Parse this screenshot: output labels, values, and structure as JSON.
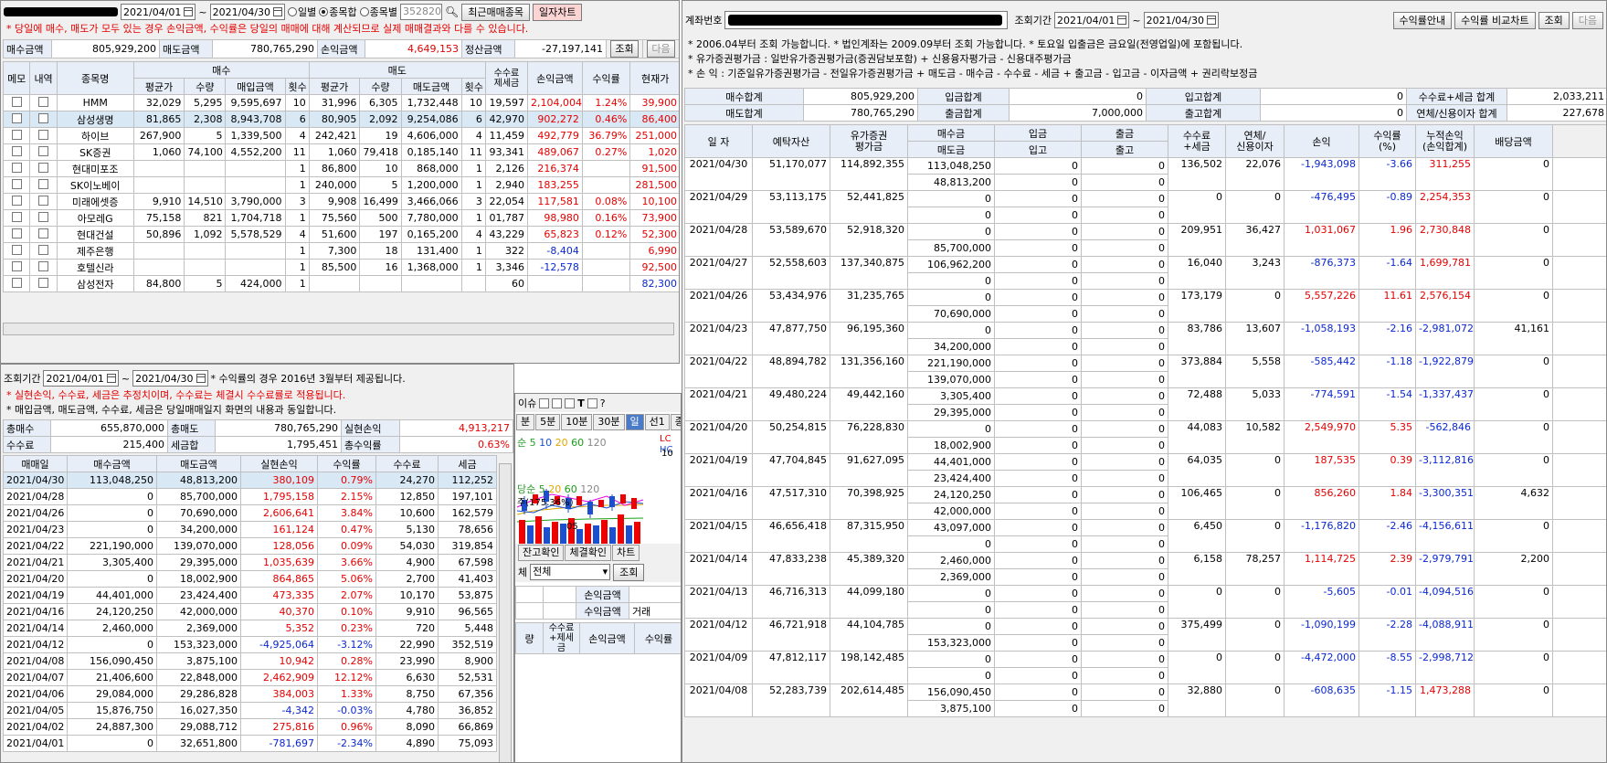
{
  "tl": {
    "date_from": "2021/04/01",
    "date_sep": "~",
    "date_to": "2021/04/30",
    "radio1": "일별",
    "radio2": "종목합",
    "radio3": "종목별",
    "code": "352820",
    "recent_btn": "최근매매종목",
    "daily_chart_btn": "일자차트",
    "warn": "* 당일에 매수, 매도가 모두 있는 경우 손익금액, 수익률은 당일의 매매에 대해 계산되므로 실제 매매결과와 다를 수 있습니다.",
    "s_buy_label": "매수금액",
    "s_buy": "805,929,200",
    "s_sell_label": "매도금액",
    "s_sell": "780,765,290",
    "s_pl_label": "손익금액",
    "s_pl": "4,649,153",
    "s_settle_label": "정산금액",
    "s_settle": "-27,197,141",
    "query_btn": "조회",
    "next_btn": "다음",
    "h_memo": "메모",
    "h_detail": "내역",
    "h_name": "종목명",
    "h_buy": "매수",
    "h_sell": "매도",
    "h_avg": "평균가",
    "h_qty": "수량",
    "h_buy_amt": "매입금액",
    "h_cnt": "횟수",
    "h_sell_amt": "매도금액",
    "h_fee": "수수료\n제세금",
    "h_pl": "손익금액",
    "h_rate": "수익률",
    "h_cur": "현재가",
    "rows": [
      {
        "name": "HMM",
        "ba": "32,029",
        "bq": "5,295",
        "bamt": "9,595,697",
        "bc": "10",
        "sa": "31,996",
        "sq": "6,305",
        "samt": "1,732,448",
        "sc": "10",
        "fee": "19,597",
        "pl": "2,104,004",
        "rate": "1.24%",
        "cur": "39,900"
      },
      {
        "name": "삼성생명",
        "ba": "81,865",
        "bq": "2,308",
        "bamt": "8,943,708",
        "bc": "6",
        "sa": "80,905",
        "sq": "2,092",
        "samt": "9,254,086",
        "sc": "6",
        "fee": "42,970",
        "pl": "902,272",
        "rate": "0.46%",
        "cur": "86,400"
      },
      {
        "name": "하이브",
        "ba": "267,900",
        "bq": "5",
        "bamt": "1,339,500",
        "bc": "4",
        "sa": "242,421",
        "sq": "19",
        "samt": "4,606,000",
        "sc": "4",
        "fee": "11,459",
        "pl": "492,779",
        "rate": "36.79%",
        "cur": "251,000"
      },
      {
        "name": "SK증권",
        "ba": "1,060",
        "bq": "74,100",
        "bamt": "4,552,200",
        "bc": "11",
        "sa": "1,060",
        "sq": "79,418",
        "samt": "0,185,140",
        "sc": "11",
        "fee": "93,341",
        "pl": "489,067",
        "rate": "0.27%",
        "cur": "1,020"
      },
      {
        "name": "현대미포조",
        "ba": "",
        "bq": "",
        "bamt": "",
        "bc": "1",
        "sa": "86,800",
        "sq": "10",
        "samt": "868,000",
        "sc": "1",
        "fee": "2,126",
        "pl": "216,374",
        "rate": "",
        "cur": "91,500"
      },
      {
        "name": "SK이노베이",
        "ba": "",
        "bq": "",
        "bamt": "",
        "bc": "1",
        "sa": "240,000",
        "sq": "5",
        "samt": "1,200,000",
        "sc": "1",
        "fee": "2,940",
        "pl": "183,255",
        "rate": "",
        "cur": "281,500"
      },
      {
        "name": "미래에셋증",
        "ba": "9,910",
        "bq": "14,510",
        "bamt": "3,790,000",
        "bc": "3",
        "sa": "9,908",
        "sq": "16,499",
        "samt": "3,466,066",
        "sc": "3",
        "fee": "22,054",
        "pl": "117,581",
        "rate": "0.08%",
        "cur": "10,100"
      },
      {
        "name": "아모레G",
        "ba": "75,158",
        "bq": "821",
        "bamt": "1,704,718",
        "bc": "1",
        "sa": "75,560",
        "sq": "500",
        "samt": "7,780,000",
        "sc": "1",
        "fee": "01,787",
        "pl": "98,980",
        "rate": "0.16%",
        "cur": "73,900"
      },
      {
        "name": "현대건설",
        "ba": "50,896",
        "bq": "1,092",
        "bamt": "5,578,529",
        "bc": "4",
        "sa": "51,600",
        "sq": "197",
        "samt": "0,165,200",
        "sc": "4",
        "fee": "43,229",
        "pl": "65,823",
        "rate": "0.12%",
        "cur": "52,300"
      },
      {
        "name": "제주은행",
        "ba": "",
        "bq": "",
        "bamt": "",
        "bc": "1",
        "sa": "7,300",
        "sq": "18",
        "samt": "131,400",
        "sc": "1",
        "fee": "322",
        "pl": "-8,404",
        "rate": "",
        "cur": "6,990"
      },
      {
        "name": "호텔신라",
        "ba": "",
        "bq": "",
        "bamt": "",
        "bc": "1",
        "sa": "85,500",
        "sq": "16",
        "samt": "1,368,000",
        "sc": "1",
        "fee": "3,346",
        "pl": "-12,578",
        "rate": "",
        "cur": "92,500"
      },
      {
        "name": "삼성전자",
        "ba": "84,800",
        "bq": "5",
        "bamt": "424,000",
        "bc": "1",
        "sa": "",
        "sq": "",
        "samt": "",
        "sc": "",
        "fee": "60",
        "pl": "",
        "rate": "",
        "cur": "82,300"
      }
    ]
  },
  "bl": {
    "period_label": "조회기간",
    "date_from": "2021/04/01",
    "date_sep": "~",
    "date_to": "2021/04/30",
    "note1": "* 수익률의 경우 2016년 3월부터 제공됩니다.",
    "note2": "* 실현손익, 수수료, 세금은 추정치이며, 수수료는 체결시 수수료률로 적용됩니다.",
    "note3": "* 매입금액, 매도금액, 수수료, 세금은 당일매매일지 화면의 내용과 동일합니다.",
    "s_buy_label": "총매수",
    "s_buy": "655,870,000",
    "s_sell_label": "총매도",
    "s_sell": "780,765,290",
    "s_pl_label": "실현손익",
    "s_pl": "4,913,217",
    "s_fee_label": "수수료",
    "s_fee": "215,400",
    "s_tax_label": "세금합",
    "s_tax": "1,795,451",
    "s_rate_label": "총수익률",
    "s_rate": "0.63%",
    "h_date": "매매일",
    "h_buy": "매수금액",
    "h_sell": "매도금액",
    "h_pl": "실현손익",
    "h_rate": "수익률",
    "h_fee": "수수료",
    "h_tax": "세금",
    "rows": [
      {
        "d": "2021/04/30",
        "b": "113,048,250",
        "s": "48,813,200",
        "pl": "380,109",
        "r": "0.79%",
        "f": "24,270",
        "t": "112,252"
      },
      {
        "d": "2021/04/28",
        "b": "0",
        "s": "85,700,000",
        "pl": "1,795,158",
        "r": "2.15%",
        "f": "12,850",
        "t": "197,101"
      },
      {
        "d": "2021/04/26",
        "b": "0",
        "s": "70,690,000",
        "pl": "2,606,641",
        "r": "3.84%",
        "f": "10,600",
        "t": "162,579"
      },
      {
        "d": "2021/04/23",
        "b": "0",
        "s": "34,200,000",
        "pl": "161,124",
        "r": "0.47%",
        "f": "5,130",
        "t": "78,656"
      },
      {
        "d": "2021/04/22",
        "b": "221,190,000",
        "s": "139,070,000",
        "pl": "128,056",
        "r": "0.09%",
        "f": "54,030",
        "t": "319,854"
      },
      {
        "d": "2021/04/21",
        "b": "3,305,400",
        "s": "29,395,000",
        "pl": "1,035,639",
        "r": "3.66%",
        "f": "4,900",
        "t": "67,598"
      },
      {
        "d": "2021/04/20",
        "b": "0",
        "s": "18,002,900",
        "pl": "864,865",
        "r": "5.06%",
        "f": "2,700",
        "t": "41,403"
      },
      {
        "d": "2021/04/19",
        "b": "44,401,000",
        "s": "23,424,400",
        "pl": "473,335",
        "r": "2.07%",
        "f": "10,170",
        "t": "53,875"
      },
      {
        "d": "2021/04/16",
        "b": "24,120,250",
        "s": "42,000,000",
        "pl": "40,370",
        "r": "0.10%",
        "f": "9,910",
        "t": "96,565"
      },
      {
        "d": "2021/04/14",
        "b": "2,460,000",
        "s": "2,369,000",
        "pl": "5,352",
        "r": "0.23%",
        "f": "720",
        "t": "5,448"
      },
      {
        "d": "2021/04/12",
        "b": "0",
        "s": "153,323,000",
        "pl": "-4,925,064",
        "r": "-3.12%",
        "f": "22,990",
        "t": "352,519"
      },
      {
        "d": "2021/04/08",
        "b": "156,090,450",
        "s": "3,875,100",
        "pl": "10,942",
        "r": "0.28%",
        "f": "23,990",
        "t": "8,900"
      },
      {
        "d": "2021/04/07",
        "b": "21,406,600",
        "s": "22,848,000",
        "pl": "2,462,909",
        "r": "12.12%",
        "f": "6,630",
        "t": "52,531"
      },
      {
        "d": "2021/04/06",
        "b": "29,084,000",
        "s": "29,286,828",
        "pl": "384,003",
        "r": "1.33%",
        "f": "8,750",
        "t": "67,356"
      },
      {
        "d": "2021/04/05",
        "b": "15,876,750",
        "s": "16,027,350",
        "pl": "-4,342",
        "r": "-0.03%",
        "f": "4,780",
        "t": "36,852"
      },
      {
        "d": "2021/04/02",
        "b": "24,887,300",
        "s": "29,088,712",
        "pl": "275,816",
        "r": "0.96%",
        "f": "8,090",
        "t": "66,869"
      },
      {
        "d": "2021/04/01",
        "b": "0",
        "s": "32,651,800",
        "pl": "-781,697",
        "r": "-2.34%",
        "f": "4,890",
        "t": "75,093"
      }
    ]
  },
  "mid": {
    "title_frag": "이슈",
    "tf": [
      "분",
      "5분",
      "10분",
      "30분",
      "일",
      "선1",
      "종1"
    ],
    "ma_label": "순",
    "ma": [
      "5",
      "10",
      "20",
      "60",
      "120"
    ],
    "vol_label": "당순",
    "vol_ma": [
      "5",
      "20",
      "60",
      "120"
    ],
    "vol_note": "주(175.36%)",
    "ytick": "10",
    "xtick": "05",
    "label_lc": "LC",
    "label_hc": "HC",
    "tabs": [
      "잔고확인",
      "체결확인",
      "차트"
    ],
    "filter_label": "체",
    "filter_value": "전체",
    "query_btn": "조회",
    "g_pl": "손익금액",
    "g_amt": "수익금액",
    "g_trade": "거래",
    "h_qty": "량",
    "h_fee": "수수료\n+제세금",
    "h_pl": "손익금액",
    "h_rate": "수익률"
  },
  "right": {
    "acct_label": "계좌번호",
    "period_label": "조회기간",
    "date_from": "2021/04/01",
    "date_sep": "~",
    "date_to": "2021/04/30",
    "btn_guide": "수익률안내",
    "btn_compare": "수익률 비교차트",
    "btn_query": "조회",
    "btn_next": "다음",
    "note1": "* 2006.04부터 조회 가능합니다.   * 법인계좌는 2009.09부터 조회 가능합니다.   * 토요일 입출금은 금요일(전영업일)에 포함됩니다.",
    "note2": "* 유가증권평가금 : 일반유가증권평가금(증권담보포함) + 신용융자평가금 - 신용대주평가금",
    "note3": "* 손          익 : 기준일유가증권평가금 - 전일유가증권평가금 + 매도금 - 매수금 - 수수료 - 세금 + 출고금 - 입고금 - 이자금액 + 권리락보정금",
    "sum": [
      [
        "매수합계",
        "805,929,200",
        "입금합계",
        "0",
        "입고합계",
        "0",
        "수수료+세금 합계",
        "2,033,211"
      ],
      [
        "매도합계",
        "780,765,290",
        "출금합계",
        "7,000,000",
        "출고합계",
        "0",
        "연체/신용이자 합계",
        "227,678"
      ]
    ],
    "h": [
      "일 자",
      "예탁자산",
      "유가증권\n평가금",
      "매수금",
      "매도금",
      "입금",
      "입고",
      "출금",
      "출고",
      "수수료\n+세금",
      "연체/\n신용이자",
      "손익",
      "수익률\n(%)",
      "누적손익\n(손익합계)",
      "배당금액"
    ],
    "rows": [
      {
        "d": "2021/04/30",
        "a": "51,170,077",
        "e": "114,892,355",
        "b": "113,048,250",
        "s": "48,813,200",
        "di": "0",
        "ri": "0",
        "wo": "0",
        "ro": "0",
        "f": "136,502",
        "i": "22,076",
        "pl": "-1,943,098",
        "r": "-3.66",
        "c": "311,255",
        "dv": "0"
      },
      {
        "d": "2021/04/29",
        "a": "53,113,175",
        "e": "52,441,825",
        "b": "0",
        "s": "0",
        "di": "0",
        "ri": "0",
        "wo": "0",
        "ro": "0",
        "f": "0",
        "i": "0",
        "pl": "-476,495",
        "r": "-0.89",
        "c": "2,254,353",
        "dv": "0"
      },
      {
        "d": "2021/04/28",
        "a": "53,589,670",
        "e": "52,918,320",
        "b": "0",
        "s": "85,700,000",
        "di": "0",
        "ri": "0",
        "wo": "0",
        "ro": "0",
        "f": "209,951",
        "i": "36,427",
        "pl": "1,031,067",
        "r": "1.96",
        "c": "2,730,848",
        "dv": "0"
      },
      {
        "d": "2021/04/27",
        "a": "52,558,603",
        "e": "137,340,875",
        "b": "106,962,200",
        "s": "0",
        "di": "0",
        "ri": "0",
        "wo": "0",
        "ro": "0",
        "f": "16,040",
        "i": "3,243",
        "pl": "-876,373",
        "r": "-1.64",
        "c": "1,699,781",
        "dv": "0"
      },
      {
        "d": "2021/04/26",
        "a": "53,434,976",
        "e": "31,235,765",
        "b": "0",
        "s": "70,690,000",
        "di": "0",
        "ri": "0",
        "wo": "0",
        "ro": "0",
        "f": "173,179",
        "i": "0",
        "pl": "5,557,226",
        "r": "11.61",
        "c": "2,576,154",
        "dv": "0"
      },
      {
        "d": "2021/04/23",
        "a": "47,877,750",
        "e": "96,195,360",
        "b": "0",
        "s": "34,200,000",
        "di": "0",
        "ri": "0",
        "wo": "0",
        "ro": "0",
        "f": "83,786",
        "i": "13,607",
        "pl": "-1,058,193",
        "r": "-2.16",
        "c": "-2,981,072",
        "dv": "41,161"
      },
      {
        "d": "2021/04/22",
        "a": "48,894,782",
        "e": "131,356,160",
        "b": "221,190,000",
        "s": "139,070,000",
        "di": "0",
        "ri": "0",
        "wo": "0",
        "ro": "0",
        "f": "373,884",
        "i": "5,558",
        "pl": "-585,442",
        "r": "-1.18",
        "c": "-1,922,879",
        "dv": "0"
      },
      {
        "d": "2021/04/21",
        "a": "49,480,224",
        "e": "49,442,160",
        "b": "3,305,400",
        "s": "29,395,000",
        "di": "0",
        "ri": "0",
        "wo": "0",
        "ro": "0",
        "f": "72,488",
        "i": "5,033",
        "pl": "-774,591",
        "r": "-1.54",
        "c": "-1,337,437",
        "dv": "0"
      },
      {
        "d": "2021/04/20",
        "a": "50,254,815",
        "e": "76,228,830",
        "b": "0",
        "s": "18,002,900",
        "di": "0",
        "ri": "0",
        "wo": "0",
        "ro": "0",
        "f": "44,083",
        "i": "10,582",
        "pl": "2,549,970",
        "r": "5.35",
        "c": "-562,846",
        "dv": "0"
      },
      {
        "d": "2021/04/19",
        "a": "47,704,845",
        "e": "91,627,095",
        "b": "44,401,000",
        "s": "23,424,400",
        "di": "0",
        "ri": "0",
        "wo": "0",
        "ro": "0",
        "f": "64,035",
        "i": "0",
        "pl": "187,535",
        "r": "0.39",
        "c": "-3,112,816",
        "dv": "0"
      },
      {
        "d": "2021/04/16",
        "a": "47,517,310",
        "e": "70,398,925",
        "b": "24,120,250",
        "s": "42,000,000",
        "di": "0",
        "ri": "0",
        "wo": "0",
        "ro": "0",
        "f": "106,465",
        "i": "0",
        "pl": "856,260",
        "r": "1.84",
        "c": "-3,300,351",
        "dv": "4,632"
      },
      {
        "d": "2021/04/15",
        "a": "46,656,418",
        "e": "87,315,950",
        "b": "43,097,000",
        "s": "0",
        "di": "0",
        "ri": "0",
        "wo": "0",
        "ro": "0",
        "f": "6,450",
        "i": "0",
        "pl": "-1,176,820",
        "r": "-2.46",
        "c": "-4,156,611",
        "dv": "0"
      },
      {
        "d": "2021/04/14",
        "a": "47,833,238",
        "e": "45,389,320",
        "b": "2,460,000",
        "s": "2,369,000",
        "di": "0",
        "ri": "0",
        "wo": "0",
        "ro": "0",
        "f": "6,158",
        "i": "78,257",
        "pl": "1,114,725",
        "r": "2.39",
        "c": "-2,979,791",
        "dv": "2,200"
      },
      {
        "d": "2021/04/13",
        "a": "46,716,313",
        "e": "44,099,180",
        "b": "0",
        "s": "0",
        "di": "0",
        "ri": "0",
        "wo": "0",
        "ro": "0",
        "f": "0",
        "i": "0",
        "pl": "-5,605",
        "r": "-0.01",
        "c": "-4,094,516",
        "dv": "0"
      },
      {
        "d": "2021/04/12",
        "a": "46,721,918",
        "e": "44,104,785",
        "b": "0",
        "s": "153,323,000",
        "di": "0",
        "ri": "0",
        "wo": "0",
        "ro": "0",
        "f": "375,499",
        "i": "0",
        "pl": "-1,090,199",
        "r": "-2.28",
        "c": "-4,088,911",
        "dv": "0"
      },
      {
        "d": "2021/04/09",
        "a": "47,812,117",
        "e": "198,142,485",
        "b": "0",
        "s": "0",
        "di": "0",
        "ri": "0",
        "wo": "0",
        "ro": "0",
        "f": "0",
        "i": "0",
        "pl": "-4,472,000",
        "r": "-8.55",
        "c": "-2,998,712",
        "dv": "0"
      },
      {
        "d": "2021/04/08",
        "a": "52,283,739",
        "e": "202,614,485",
        "b": "156,090,450",
        "s": "3,875,100",
        "di": "0",
        "ri": "0",
        "wo": "0",
        "ro": "0",
        "f": "32,880",
        "i": "0",
        "pl": "-608,635",
        "r": "-1.15",
        "c": "1,473,288",
        "dv": "0"
      }
    ]
  },
  "colors": {
    "red": "#e60000",
    "blue": "#0a28d0",
    "header": "#e7eef7",
    "selected": "#d8e8f5"
  }
}
